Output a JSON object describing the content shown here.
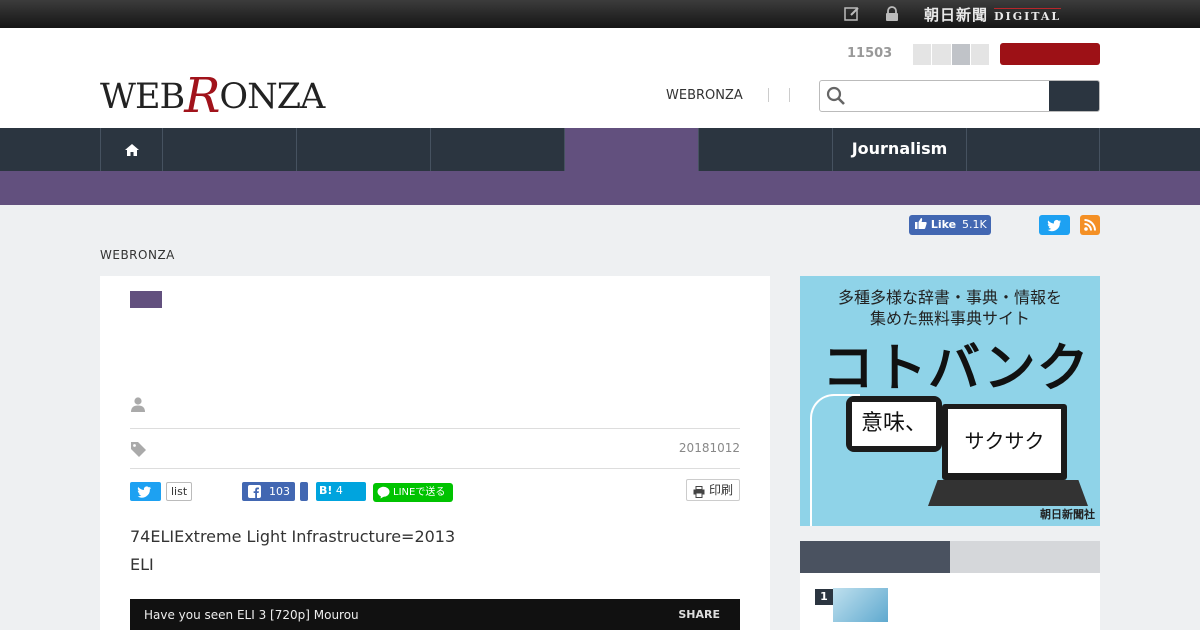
{
  "topbar": {
    "brand": "朝日新聞",
    "brand_sub": "DIGITAL",
    "icons": [
      "edit-icon",
      "lock-icon"
    ]
  },
  "header": {
    "logo_part1": "WEB",
    "logo_r": "R",
    "logo_part2": "ONZA",
    "count": "11503",
    "link_webronza": "WEBRONZA",
    "search_placeholder": ""
  },
  "nav": {
    "items": [
      "",
      "",
      "",
      "",
      "",
      "Journalism",
      ""
    ],
    "active_index": 4
  },
  "social": {
    "fb_like_label": "Like",
    "fb_like_count": "5.1K"
  },
  "breadcrumb": "WEBRONZA",
  "article": {
    "date": "20181012",
    "share": {
      "list_label": "list",
      "fb_count": "103",
      "hatena_label": "B!",
      "hatena_count": "4",
      "line_label": "LINEで送る",
      "print_label": "印刷"
    },
    "body_line1": "74ELIExtreme Light Infrastructure=2013",
    "body_line2": "ELI",
    "video": {
      "title": "Have you seen ELI 3 [720p] Mourou",
      "share_label": "SHARE"
    }
  },
  "sidebar": {
    "ad": {
      "line1": "多種多様な辞書・事典・情報を",
      "line2": "集めた無料事典サイト",
      "headline": "コトバンク",
      "phone_text": "意味、",
      "laptop_text": "サクサク",
      "brand": "朝日新聞社"
    },
    "ranking": {
      "first_number": "1"
    }
  },
  "colors": {
    "brand_purple": "#62507e",
    "nav_dark": "#2b3540",
    "login_red": "#9d1116",
    "twitter": "#1da1f2",
    "facebook": "#4267b2",
    "line": "#00c300",
    "hatena": "#00a4de",
    "rss": "#f49025",
    "ad_bg": "#8fd3e8"
  }
}
